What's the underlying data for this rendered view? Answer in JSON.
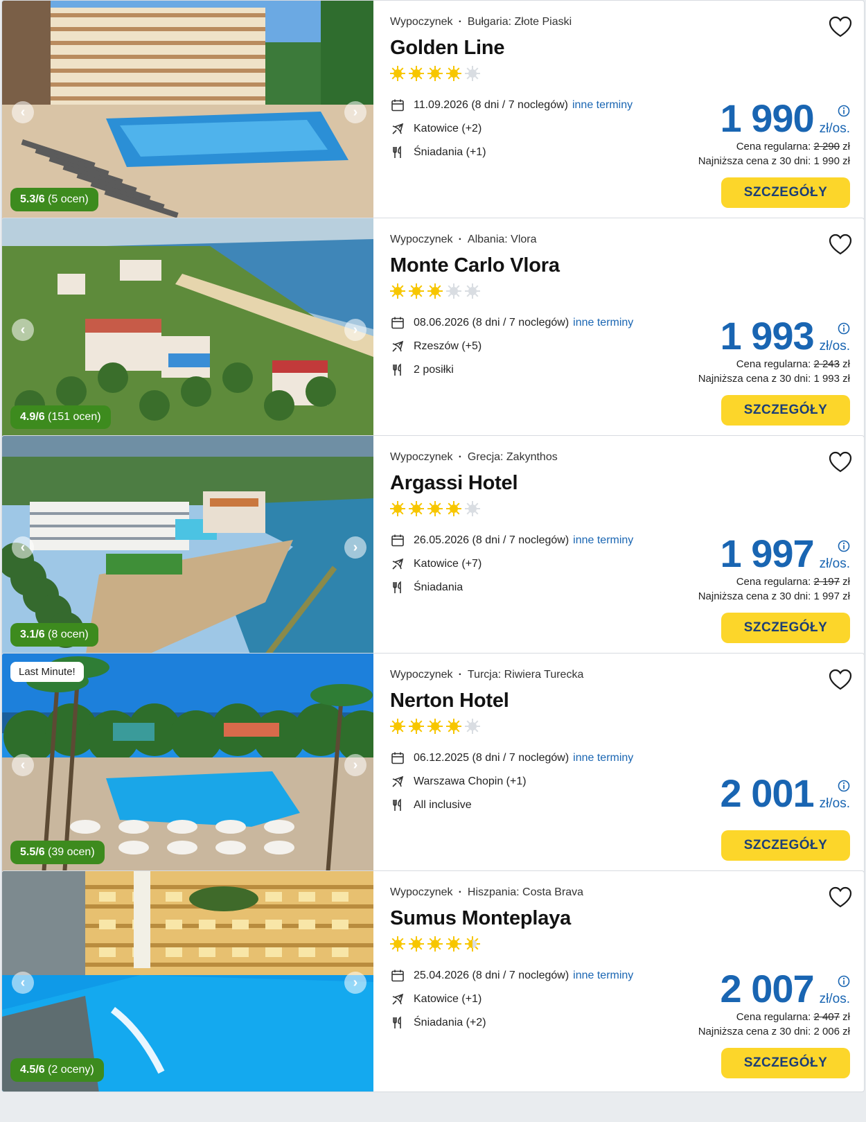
{
  "offers": [
    {
      "category": "Wypoczynek",
      "destination": "Bułgaria: Złote Piaski",
      "name": "Golden Line",
      "stars_full": 4,
      "stars_half": 0,
      "stars_total": 5,
      "date": "11.09.2026 (8 dni / 7 noclegów)",
      "other_dates": "inne terminy",
      "departure": "Katowice (+2)",
      "board": "Śniadania (+1)",
      "price": "1 990",
      "per": "zł/os.",
      "regular_label": "Cena regularna:",
      "regular_price": "2 290",
      "regular_currency": "zł",
      "lowest_label": "Najniższa cena z 30 dni:",
      "lowest_price": "1 990 zł",
      "rating_score": "5.3/6",
      "rating_count": "(5 ocen)",
      "badge": "",
      "button": "SZCZEGÓŁY",
      "scene": "pool-hotel"
    },
    {
      "category": "Wypoczynek",
      "destination": "Albania: Vlora",
      "name": "Monte Carlo Vlora",
      "stars_full": 3,
      "stars_half": 0,
      "stars_total": 5,
      "date": "08.06.2026 (8 dni / 7 noclegów)",
      "other_dates": "inne terminy",
      "departure": "Rzeszów (+5)",
      "board": "2 posiłki",
      "price": "1 993",
      "per": "zł/os.",
      "regular_label": "Cena regularna:",
      "regular_price": "2 243",
      "regular_currency": "zł",
      "lowest_label": "Najniższa cena z 30 dni:",
      "lowest_price": "1 993 zł",
      "rating_score": "4.9/6",
      "rating_count": "(151 ocen)",
      "badge": "",
      "button": "SZCZEGÓŁY",
      "scene": "coast"
    },
    {
      "category": "Wypoczynek",
      "destination": "Grecja: Zakynthos",
      "name": "Argassi Hotel",
      "stars_full": 4,
      "stars_half": 0,
      "stars_total": 5,
      "date": "26.05.2026 (8 dni / 7 noclegów)",
      "other_dates": "inne terminy",
      "departure": "Katowice (+7)",
      "board": "Śniadania",
      "price": "1 997",
      "per": "zł/os.",
      "regular_label": "Cena regularna:",
      "regular_price": "2 197",
      "regular_currency": "zł",
      "lowest_label": "Najniższa cena z 30 dni:",
      "lowest_price": "1 997 zł",
      "rating_score": "3.1/6",
      "rating_count": "(8 ocen)",
      "badge": "",
      "button": "SZCZEGÓŁY",
      "scene": "beach-hotel"
    },
    {
      "category": "Wypoczynek",
      "destination": "Turcja: Riwiera Turecka",
      "name": "Nerton Hotel",
      "stars_full": 4,
      "stars_half": 0,
      "stars_total": 5,
      "date": "06.12.2025 (8 dni / 7 noclegów)",
      "other_dates": "inne terminy",
      "departure": "Warszawa Chopin (+1)",
      "board": "All inclusive",
      "price": "2 001",
      "per": "zł/os.",
      "regular_label": "",
      "regular_price": "",
      "regular_currency": "",
      "lowest_label": "",
      "lowest_price": "",
      "rating_score": "5.5/6",
      "rating_count": "(39 ocen)",
      "badge": "Last Minute!",
      "button": "SZCZEGÓŁY",
      "scene": "palm-pool"
    },
    {
      "category": "Wypoczynek",
      "destination": "Hiszpania: Costa Brava",
      "name": "Sumus Monteplaya",
      "stars_full": 4,
      "stars_half": 1,
      "stars_total": 5,
      "date": "25.04.2026 (8 dni / 7 noclegów)",
      "other_dates": "inne terminy",
      "departure": "Katowice (+1)",
      "board": "Śniadania (+2)",
      "price": "2 007",
      "per": "zł/os.",
      "regular_label": "Cena regularna:",
      "regular_price": "2 407",
      "regular_currency": "zł",
      "lowest_label": "Najniższa cena z 30 dni:",
      "lowest_price": "2 006 zł",
      "rating_score": "4.5/6",
      "rating_count": "(2 oceny)",
      "badge": "",
      "button": "SZCZEGÓŁY",
      "scene": "night-pool"
    }
  ],
  "colors": {
    "price_blue": "#1965b2",
    "button_yellow": "#fcd62a",
    "button_text": "#1c3e76",
    "rating_green": "#3d8b1e",
    "star_gold": "#f7c600",
    "star_empty": "#d9dde2"
  },
  "icons": {
    "calendar": "calendar-icon",
    "plane": "plane-icon",
    "meal": "cutlery-icon",
    "favorite": "heart-icon",
    "info": "info-icon",
    "prev": "chevron-left-icon",
    "next": "chevron-right-icon"
  }
}
